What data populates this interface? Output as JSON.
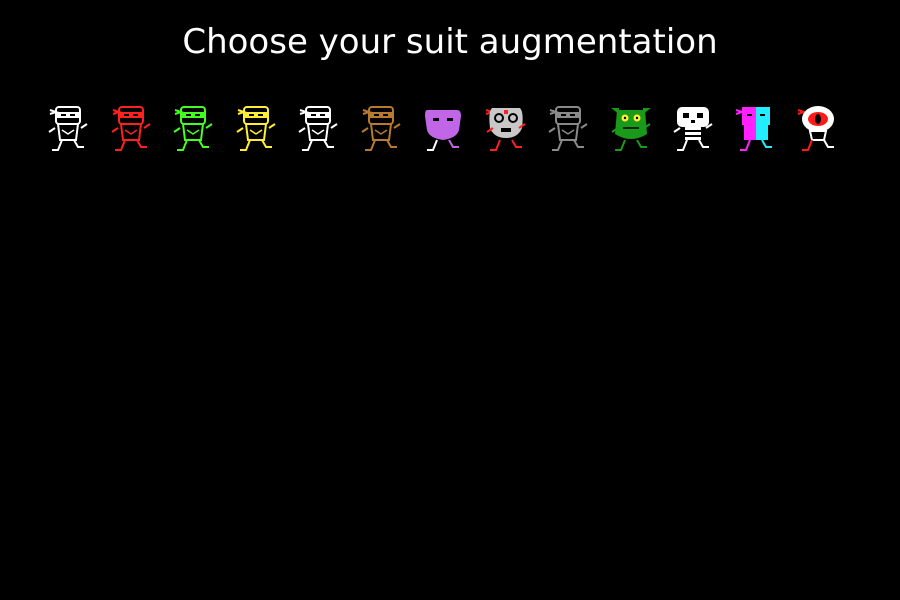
{
  "screen": {
    "title": "Choose your suit augmentation"
  },
  "suits": [
    {
      "id": "white-ninja",
      "kind": "ninja",
      "color": "#ffffff",
      "band": "#ffffff"
    },
    {
      "id": "red-ninja",
      "kind": "ninja",
      "color": "#ff2020",
      "band": "#ff2020"
    },
    {
      "id": "green-ninja",
      "kind": "ninja",
      "color": "#44ff22",
      "band": "#44ff22"
    },
    {
      "id": "yellow-ninja",
      "kind": "ninja",
      "color": "#ffee33",
      "band": "#ffee33"
    },
    {
      "id": "white-ninja-2",
      "kind": "ninja",
      "color": "#ffffff",
      "band": "#ffffff"
    },
    {
      "id": "brown-ninja",
      "kind": "ninja",
      "color": "#b87a2e",
      "band": "#b87a2e"
    },
    {
      "id": "purple-blob",
      "kind": "blob",
      "color": "#c266e8",
      "band": "#c266e8"
    },
    {
      "id": "robot",
      "kind": "robot",
      "color": "#c8c8c8",
      "band": "#ff2020"
    },
    {
      "id": "gray-ninja",
      "kind": "ninja",
      "color": "#8a8a8a",
      "band": "#8a8a8a"
    },
    {
      "id": "goblin",
      "kind": "goblin",
      "color": "#1a9a1a",
      "band": "#1a9a1a"
    },
    {
      "id": "skeleton",
      "kind": "skeleton",
      "color": "#ffffff",
      "band": "#ffffff"
    },
    {
      "id": "split-ninja",
      "kind": "split",
      "color": "#ff22ff",
      "band": "#22eeff"
    },
    {
      "id": "eyeball",
      "kind": "eyeball",
      "color": "#ffffff",
      "band": "#ff1a1a"
    }
  ]
}
